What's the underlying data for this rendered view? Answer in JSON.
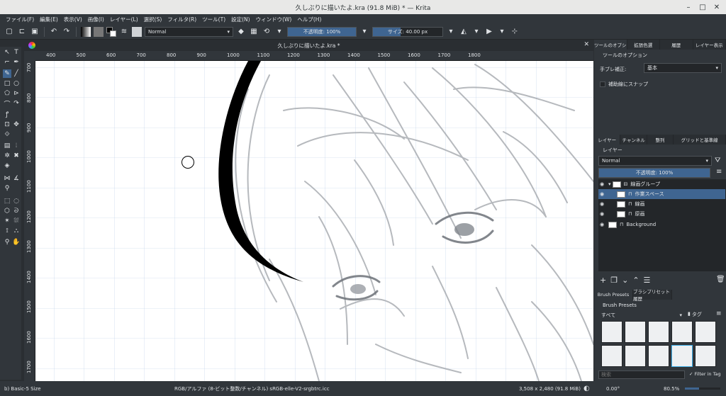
{
  "window": {
    "title": "久しぶりに描いたよ.kra (91.8 MiB)  * — Krita"
  },
  "menu": [
    "ファイル(F)",
    "編集(E)",
    "表示(V)",
    "画像(I)",
    "レイヤー(L)",
    "選択(S)",
    "フィルタ(R)",
    "ツール(T)",
    "設定(N)",
    "ウィンドウ(W)",
    "ヘルプ(H)"
  ],
  "toolbar": {
    "blend_mode": "Normal",
    "opacity_label": "不透明度: 100%",
    "opacity_value": 1.0,
    "size_label": "サイズ: 40.00 px",
    "size_value": 0.4,
    "fg_color": "#000000",
    "bg_color": "#ffffff"
  },
  "document": {
    "tab_title": "久しぶりに描いたよ.kra *",
    "h_ruler": [
      "400",
      "500",
      "600",
      "700",
      "800",
      "900",
      "1000",
      "1100",
      "1200",
      "1300",
      "1400",
      "1500",
      "1600",
      "1700",
      "1800"
    ],
    "v_ruler": [
      "700",
      "800",
      "900",
      "1000",
      "1100",
      "1200",
      "1300",
      "1400",
      "1500",
      "1600",
      "1700"
    ]
  },
  "dock_top": {
    "tabs": [
      "ツールのオプシ",
      "拡張色選",
      "履歴",
      "レイヤー表示"
    ],
    "header": "ツールのオプション",
    "stabilizer_label": "手ブレ補正:",
    "stabilizer_value": "基本",
    "assist_label": "補助線にスナップ"
  },
  "layers_dock": {
    "tabs": [
      "レイヤー",
      "チャンネル",
      "整列",
      "グリッドと基準線"
    ],
    "header": "レイヤー",
    "blend_mode": "Normal",
    "opacity_label": "不透明度: 100%",
    "layers": [
      {
        "name": "線画グループ",
        "indent": 0,
        "selected": false
      },
      {
        "name": "作業スペース",
        "indent": 1,
        "selected": true
      },
      {
        "name": "線画",
        "indent": 1,
        "selected": false
      },
      {
        "name": "原画",
        "indent": 1,
        "selected": false
      },
      {
        "name": "Background",
        "indent": 0,
        "selected": false
      }
    ]
  },
  "brush_dock": {
    "tabs": [
      "Brush Presets",
      "ブラシプリセット履歴"
    ],
    "header": "Brush Presets",
    "filter_value": "すべて",
    "tag_label": "タグ",
    "search_placeholder": "検索",
    "filter_in_tag": "Filter in Tag"
  },
  "status": {
    "brush": "b) Basic-5 Size",
    "color_space": "RGB/アルファ (8-ビット整数/チャンネル)  sRGB-elle-V2-srgbtrc.icc",
    "image_size": "3,508 x 2,480 (91.8 MiB)",
    "rotation": "0.00°",
    "zoom": "80.5%"
  }
}
